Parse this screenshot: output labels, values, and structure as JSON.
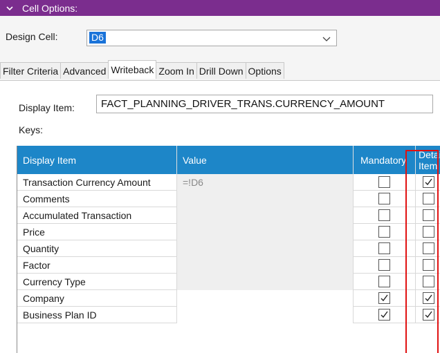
{
  "panel": {
    "title": "Cell Options:"
  },
  "design": {
    "label": "Design Cell:",
    "value": "D6"
  },
  "tabs": [
    {
      "label": "Filter Criteria"
    },
    {
      "label": "Advanced"
    },
    {
      "label": "Writeback"
    },
    {
      "label": "Zoom In"
    },
    {
      "label": "Drill Down"
    },
    {
      "label": "Options"
    }
  ],
  "active_tab": "Writeback",
  "display_item": {
    "label": "Display Item:",
    "value": "FACT_PLANNING_DRIVER_TRANS.CURRENCY_AMOUNT"
  },
  "keys_label": "Keys:",
  "grid": {
    "headers": {
      "display": "Display Item",
      "value": "Value",
      "mandatory": "Mandatory",
      "detail": "Detail Item"
    },
    "rows": [
      {
        "name": "Transaction Currency Amount",
        "value": "=!D6",
        "mandatory": false,
        "detail": true
      },
      {
        "name": "Comments",
        "value": "",
        "mandatory": false,
        "detail": false
      },
      {
        "name": "Accumulated Transaction",
        "value": "",
        "mandatory": false,
        "detail": false
      },
      {
        "name": "Price",
        "value": "",
        "mandatory": false,
        "detail": false
      },
      {
        "name": "Quantity",
        "value": "",
        "mandatory": false,
        "detail": false
      },
      {
        "name": "Factor",
        "value": "",
        "mandatory": false,
        "detail": false
      },
      {
        "name": "Currency Type",
        "value": "",
        "mandatory": false,
        "detail": false
      },
      {
        "name": "Company",
        "value": "",
        "mandatory": true,
        "detail": true
      },
      {
        "name": "Business Plan ID",
        "value": "",
        "mandatory": true,
        "detail": true
      }
    ]
  },
  "icons": {
    "collapse": "chevron-down-icon",
    "dropdown": "dropdown-arrow-icon",
    "check": "checkmark-icon"
  },
  "colors": {
    "header": "#7b2d8e",
    "grid_header": "#1d86c8",
    "selection": "#1a73d9",
    "highlight": "#e01010"
  }
}
